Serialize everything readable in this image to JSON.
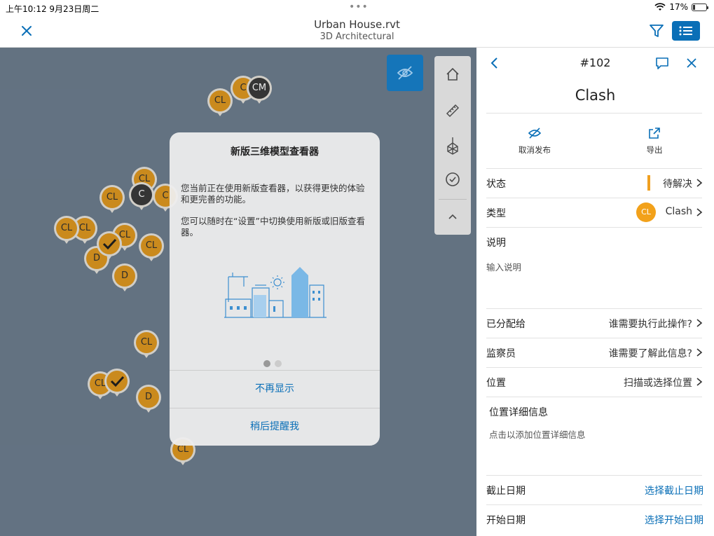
{
  "status_bar": {
    "time": "上午10:12  9月23日周二",
    "dots": "•••",
    "battery": "17%"
  },
  "header": {
    "title": "Urban House.rvt",
    "subtitle": "3D Architectural"
  },
  "viewer": {
    "pins": [
      "CL",
      "C",
      "CM",
      "CL",
      "C",
      "C",
      "CL",
      "CL",
      "CL",
      "CL",
      "CL",
      "D",
      "D",
      "CL",
      "CL",
      "D",
      "CL",
      "CL",
      "CL",
      "CL"
    ],
    "pin_dark_label": "CM"
  },
  "modal": {
    "title": "新版三维模型查看器",
    "paragraph1": "您当前正在使用新版查看器，以获得更快的体验和更完善的功能。",
    "paragraph2": "您可以随时在“设置”中切换使用新版或旧版查看器。",
    "button_dont_show": "不再显示",
    "button_remind_later": "稍后提醒我"
  },
  "panel": {
    "issue_number": "#102",
    "title": "Clash",
    "actions": {
      "unpublish": "取消发布",
      "export": "导出"
    },
    "rows": {
      "status": {
        "label": "状态",
        "value": "待解决"
      },
      "type": {
        "label": "类型",
        "avatar": "CL",
        "value": "Clash"
      },
      "description": {
        "label": "说明",
        "placeholder": "输入说明"
      },
      "assigned": {
        "label": "已分配给",
        "value": "谁需要执行此操作?"
      },
      "watchers": {
        "label": "监察员",
        "value": "谁需要了解此信息?"
      },
      "location": {
        "label": "位置",
        "value": "扫描或选择位置"
      },
      "location_details": {
        "label": "位置详细信息",
        "placeholder": "点击以添加位置详细信息"
      },
      "due_date": {
        "label": "截止日期",
        "value": "选择截止日期"
      },
      "start_date": {
        "label": "开始日期",
        "value": "选择开始日期"
      }
    }
  },
  "colors": {
    "accent": "#0a6fb7",
    "status": "#f0a020",
    "pin": "#c98512"
  }
}
